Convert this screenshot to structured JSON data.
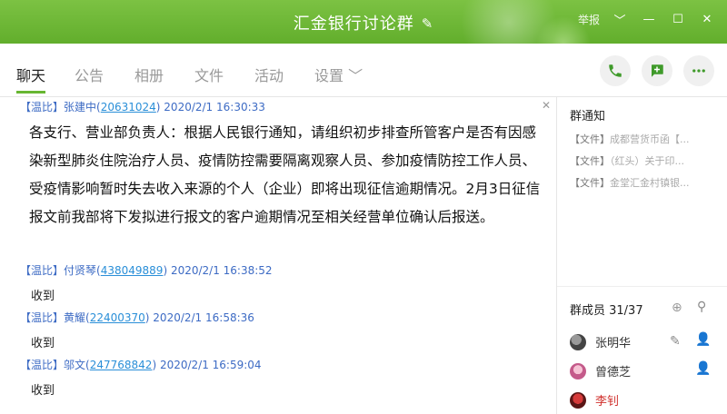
{
  "window": {
    "title": "汇金银行讨论群",
    "report_label": "举报",
    "controls": {
      "dropdown": "﹀",
      "minimize": "—",
      "maximize": "☐",
      "close": "✕"
    },
    "accent_color": "#67b632"
  },
  "tabs": [
    "聊天",
    "公告",
    "相册",
    "文件",
    "活动",
    "设置 ﹀"
  ],
  "messages": [
    {
      "tag": "【温比】",
      "name": "张建中",
      "qq": "20631024",
      "time": "2020/2/1 16:30:33",
      "text": "各支行、营业部负责人：根据人民银行通知，请组织初步排查所管客户是否有因感染新型肺炎住院治疗人员、疫情防控需要隔离观察人员、参加疫情防控工作人员、受疫情影响暂时失去收入来源的个人（企业）即将出现征信逾期情况。2月3日征信报文前我部将下发拟进行报文的客户逾期情况至相关经营单位确认后报送。"
    },
    {
      "tag": "【温比】",
      "name": "付贤琴",
      "qq": "438049889",
      "time": "2020/2/1 16:38:52",
      "text": "收到"
    },
    {
      "tag": "【温比】",
      "name": "黄耀",
      "qq": "22400370",
      "time": "2020/2/1 16:58:36",
      "text": "收到"
    },
    {
      "tag": "【温比】",
      "name": "邬文",
      "qq": "247768842",
      "time": "2020/2/1 16:59:04",
      "text": "收到"
    }
  ],
  "notice": {
    "heading": "群通知",
    "items": [
      {
        "type": "【文件】",
        "title": "成都营货币函【..."
      },
      {
        "type": "【文件】",
        "title": "（红头）关于印..."
      },
      {
        "type": "【文件】",
        "title": "金堂汇金村镇银..."
      }
    ]
  },
  "members": {
    "heading": "群成员 31/37",
    "list": [
      {
        "name": "张明华",
        "color": "#333333"
      },
      {
        "name": "曾德芝",
        "color": "#333333"
      },
      {
        "name": "李钊",
        "color": "#d0302c"
      }
    ]
  }
}
